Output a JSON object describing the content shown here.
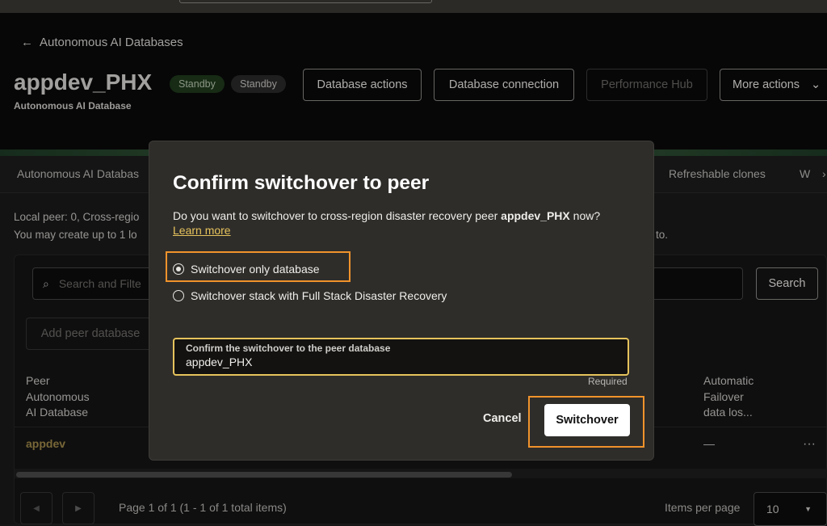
{
  "header": {
    "back_label": "Autonomous AI Databases",
    "title": "appdev_PHX",
    "subtitle": "Autonomous AI Database",
    "badges": [
      "Standby",
      "Standby"
    ],
    "actions": [
      "Database actions",
      "Database connection",
      "Performance Hub",
      "More actions"
    ]
  },
  "tabs": [
    "Autonomous AI Databas",
    "Refreshable clones",
    "W"
  ],
  "info": {
    "line1": "Local peer: 0, Cross-regio",
    "line2": "You may create up to 1 lo",
    "line2_end": "to."
  },
  "table": {
    "search_placeholder": "Search and Filte",
    "search_button": "Search",
    "add_button": "Add peer database",
    "col1": [
      "Peer",
      "Autonomous",
      "AI Database"
    ],
    "col_last": [
      "Automatic",
      "Failover",
      "data los..."
    ],
    "row": {
      "name": "appdev",
      "failover": "—",
      "more": "···"
    }
  },
  "pagination": {
    "text": "Page 1 of 1 (1 - 1 of 1 total items)",
    "items_label": "Items per page",
    "items_value": "10"
  },
  "dialog": {
    "title": "Confirm switchover to peer",
    "question_pre": "Do you want to switchover to cross-region disaster recovery peer ",
    "question_bold": "appdev_PHX",
    "question_post": " now?",
    "learn_more": "Learn more",
    "options": [
      "Switchover only database",
      "Switchover stack with Full Stack Disaster Recovery"
    ],
    "selected": 0,
    "field_label": "Confirm the switchover to the peer database",
    "field_value": "appdev_PHX",
    "required": "Required",
    "cancel": "Cancel",
    "confirm": "Switchover"
  },
  "colors": {
    "accent_link": "#d9b75a",
    "highlight": "#f0932b",
    "field_border": "#e6c35c",
    "badge_green": "#1f3a1c"
  }
}
